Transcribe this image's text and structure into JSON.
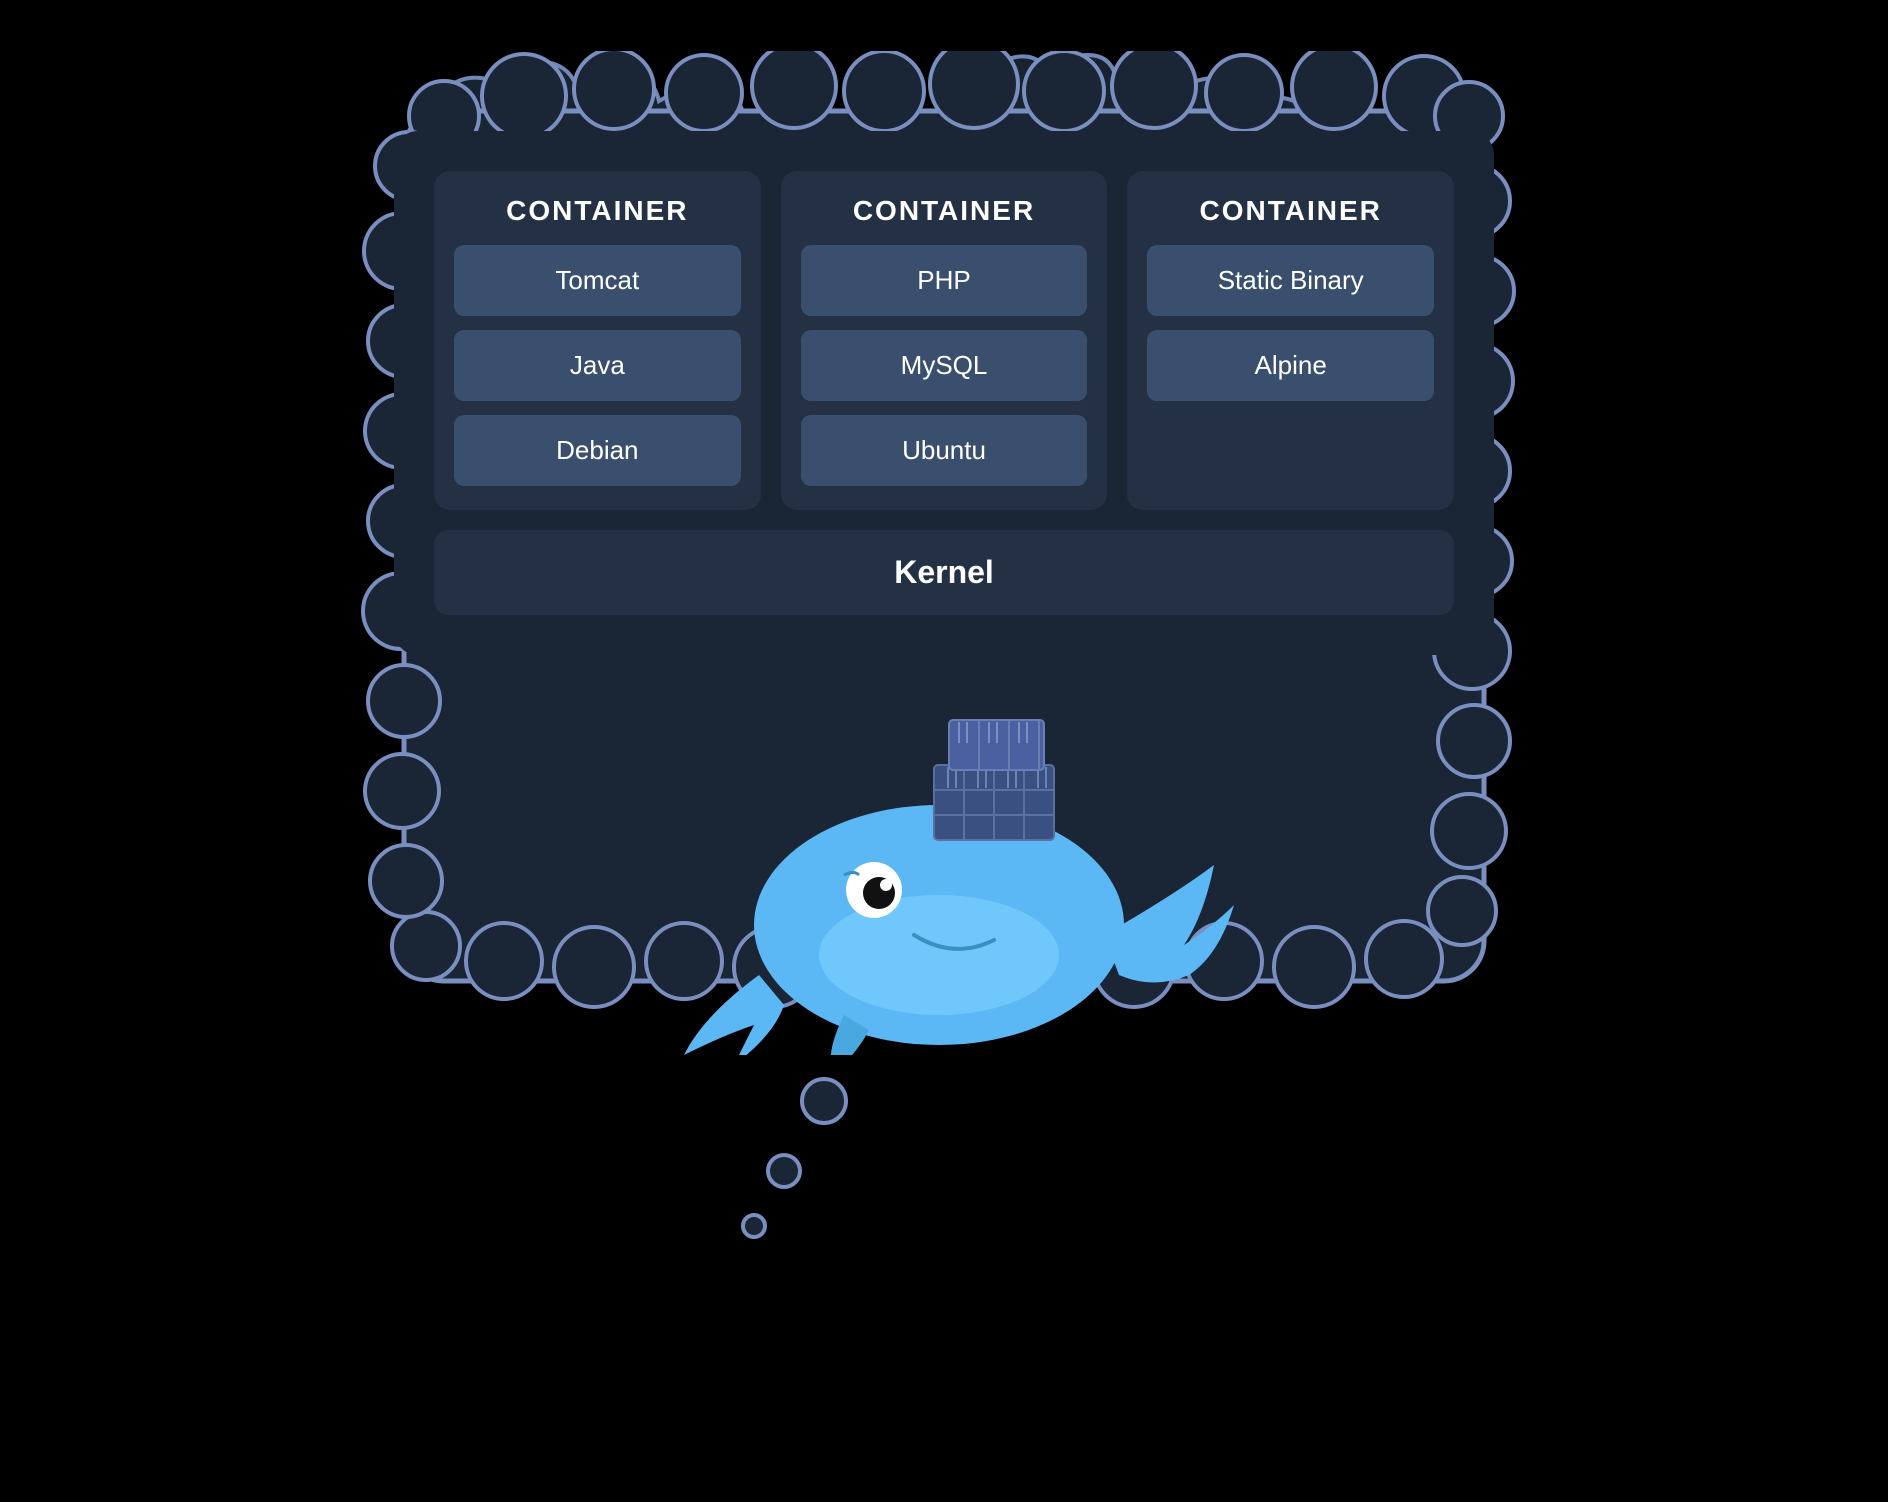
{
  "diagram": {
    "containers": [
      {
        "id": "container1",
        "title": "CONTAINER",
        "layers": [
          "Tomcat",
          "Java",
          "Debian"
        ]
      },
      {
        "id": "container2",
        "title": "CONTAINER",
        "layers": [
          "PHP",
          "MySQL",
          "Ubuntu"
        ]
      },
      {
        "id": "container3",
        "title": "CONTAINER",
        "layers": [
          "Static Binary",
          "Alpine"
        ]
      }
    ],
    "kernel_label": "Kernel",
    "colors": {
      "outer_bg": "#000000",
      "main_bg": "#1a2535",
      "container_bg": "#243044",
      "layer_bg": "#3a4f6e",
      "text": "#ffffff",
      "cloud_border": "#7a8fc0"
    }
  }
}
